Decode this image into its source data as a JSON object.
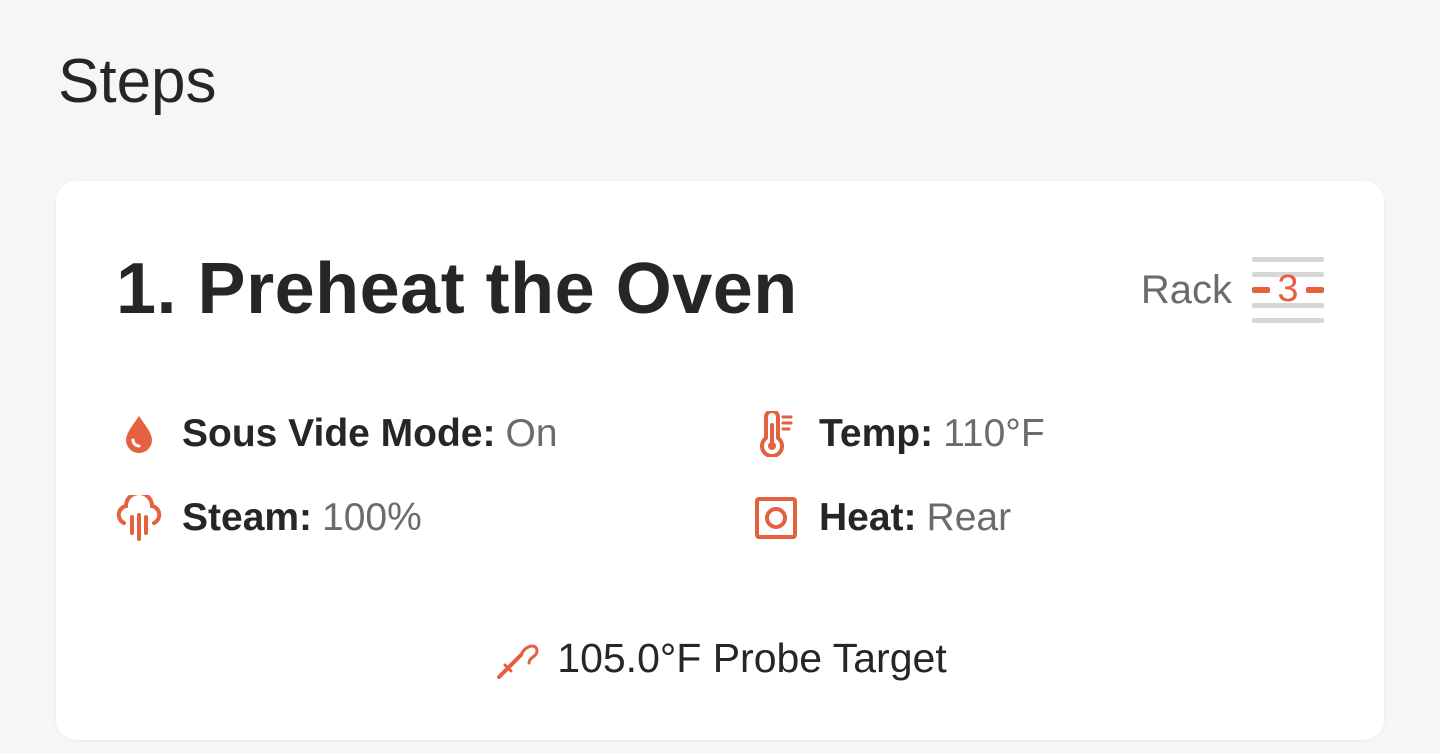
{
  "section": {
    "title": "Steps"
  },
  "step": {
    "title": "1. Preheat the Oven",
    "rack": {
      "label": "Rack",
      "number": "3",
      "icon": "rack-position-icon"
    },
    "params": [
      {
        "icon": "water-drop-icon",
        "label": "Sous Vide Mode:",
        "value": "On"
      },
      {
        "icon": "steam-icon",
        "label": "Steam:",
        "value": "100%"
      },
      {
        "icon": "thermometer-icon",
        "label": "Temp:",
        "value": "110°F"
      },
      {
        "icon": "rear-heat-icon",
        "label": "Heat:",
        "value": "Rear"
      }
    ],
    "probe": {
      "icon": "probe-icon",
      "text": "105.0°F Probe Target"
    }
  },
  "colors": {
    "accent": "#e4603f",
    "background": "#f6f6f6",
    "card": "#ffffff",
    "text": "#262626",
    "muted": "#6b6b6b",
    "rack_lines": "#d6d6d6"
  }
}
